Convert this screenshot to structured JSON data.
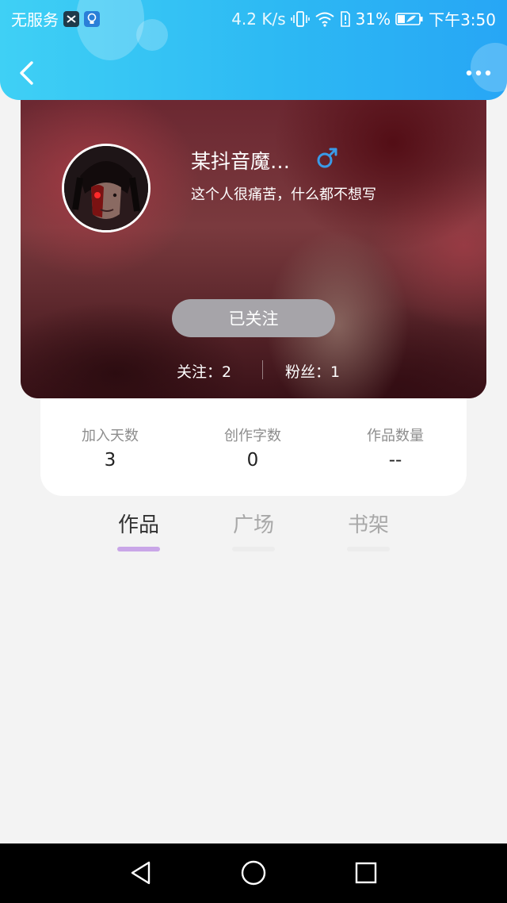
{
  "status_bar": {
    "carrier": "无服务",
    "net_speed": "4.2 K/s",
    "battery_percent": "31%",
    "time": "下午3:50",
    "icons": [
      "capcut-icon",
      "lightbulb-icon",
      "vibrate-icon",
      "wifi-icon",
      "sim-alert-icon",
      "battery-charging-icon"
    ]
  },
  "header": {
    "background_color": "#2db9f3",
    "back_icon": "chevron-left-icon",
    "more_icon": "more-dots-icon"
  },
  "profile": {
    "name": "某抖音魔…",
    "gender_icon": "male-icon",
    "gender_color": "#3a9be8",
    "bio": "这个人很痛苦，什么都不想写",
    "follow_button_label": "已关注",
    "following_label": "关注：2",
    "fans_label": "粉丝：1"
  },
  "stats": [
    {
      "label": "加入天数",
      "value": "3"
    },
    {
      "label": "创作字数",
      "value": "0"
    },
    {
      "label": "作品数量",
      "value": "--"
    }
  ],
  "tabs": [
    {
      "label": "作品",
      "active": true
    },
    {
      "label": "广场",
      "active": false
    },
    {
      "label": "书架",
      "active": false
    }
  ],
  "colors": {
    "tab_active_text": "#333333",
    "tab_inactive_text": "#a8a8a8",
    "tab_active_underline": "#c9a6e8",
    "tab_inactive_underline": "#ececec",
    "follow_button_bg": "#a6a4a9"
  },
  "nav_bar": {
    "back_icon": "triangle-back-icon",
    "home_icon": "circle-home-icon",
    "recents_icon": "square-recents-icon"
  }
}
